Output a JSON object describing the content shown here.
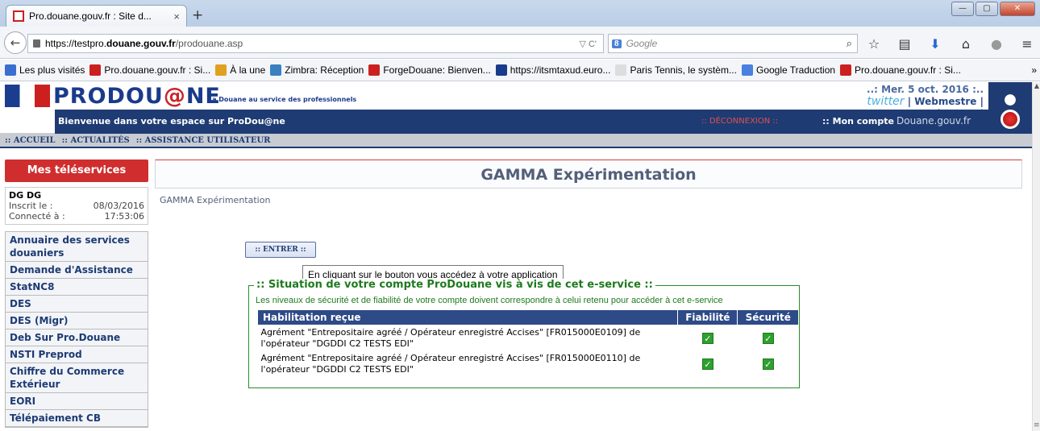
{
  "browser": {
    "tab_title": "Pro.douane.gouv.fr : Site d...",
    "tab_close": "×",
    "new_tab": "+",
    "url_prefix": "https://testpro.",
    "url_host": "douane.gouv.fr",
    "url_path": "/prodouane.asp",
    "url_icons": "▽ C'",
    "search_engine": "8",
    "search_placeholder": "Google",
    "bookmarks": [
      {
        "label": "Les plus visités",
        "color": "#3a6fd0"
      },
      {
        "label": "Pro.douane.gouv.fr : Si...",
        "color": "#cc1f1f"
      },
      {
        "label": "À la une",
        "color": "#e0a020"
      },
      {
        "label": "Zimbra: Réception",
        "color": "#3a80c0"
      },
      {
        "label": "ForgeDouane: Bienven...",
        "color": "#cc2020"
      },
      {
        "label": "https://itsmtaxud.euro...",
        "color": "#1a3a8a"
      },
      {
        "label": "Paris Tennis, le systèm...",
        "color": "#dddddd"
      },
      {
        "label": "Google Traduction",
        "color": "#4a80e0"
      },
      {
        "label": "Pro.douane.gouv.fr : Si...",
        "color": "#cc1f1f"
      }
    ],
    "bookmarks_more": "»"
  },
  "header": {
    "logo_a": "PRODOU",
    "logo_b": "@",
    "logo_c": "NE",
    "tagline": "La Douane au service des professionnels",
    "date": "..: Mer. 5 oct. 2016 :..",
    "twitter": "twitter",
    "links": "| Webmestre | Assistance |",
    "welcome": "Bienvenue dans votre espace sur ProDou@ne",
    "deconnexion": ":: DÉCONNEXION ::",
    "mon_compte": ":: Mon compte",
    "douane_gouv": "Douane.gouv.fr"
  },
  "menu": [
    ":: ACCUEIL",
    ":: ACTUALITÉS",
    ":: ASSISTANCE UTILISATEUR"
  ],
  "sidebar": {
    "title": "Mes téléservices",
    "user_name": "DG DG",
    "inscrit_label": "Inscrit le   :",
    "inscrit_value": "08/03/2016",
    "connecte_label": "Connecté à   :",
    "connecte_value": "17:53:06",
    "items": [
      "Annuaire des services douaniers",
      "Demande d'Assistance",
      "StatNC8",
      "DES",
      "DES (Migr)",
      "Deb Sur Pro.Douane",
      "NSTI Preprod",
      "Chiffre du Commerce Extérieur",
      "EORI",
      "Télépaiement CB"
    ]
  },
  "main": {
    "title": "GAMMA Expérimentation",
    "breadcrumb": "GAMMA Expérimentation",
    "enter_button": ":: ENTRER ::",
    "tooltip": "En cliquant sur le bouton vous accédez à votre application",
    "fieldset_legend": ":: Situation de votre compte ProDouane vis à vis de cet e-service ::",
    "fieldset_desc": "Les niveaux de sécurité et de fiabilité de votre compte doivent correspondre à celui retenu pour accéder à cet e-service",
    "table_headers": [
      "Habilitation reçue",
      "Fiabilité",
      "Sécurité"
    ],
    "rows": [
      {
        "line1": "Agrément \"Entrepositaire agréé / Opérateur enregistré Accises\" [FR015000E0109] de",
        "line2": "l'opérateur \"DGDDI C2 TESTS EDI\"",
        "fiabilite": true,
        "securite": true
      },
      {
        "line1": "Agrément \"Entrepositaire agréé / Opérateur enregistré Accises\" [FR015000E0110] de",
        "line2": "l'opérateur \"DGDDI C2 TESTS EDI\"",
        "fiabilite": true,
        "securite": true
      }
    ],
    "check_glyph": "✓"
  }
}
